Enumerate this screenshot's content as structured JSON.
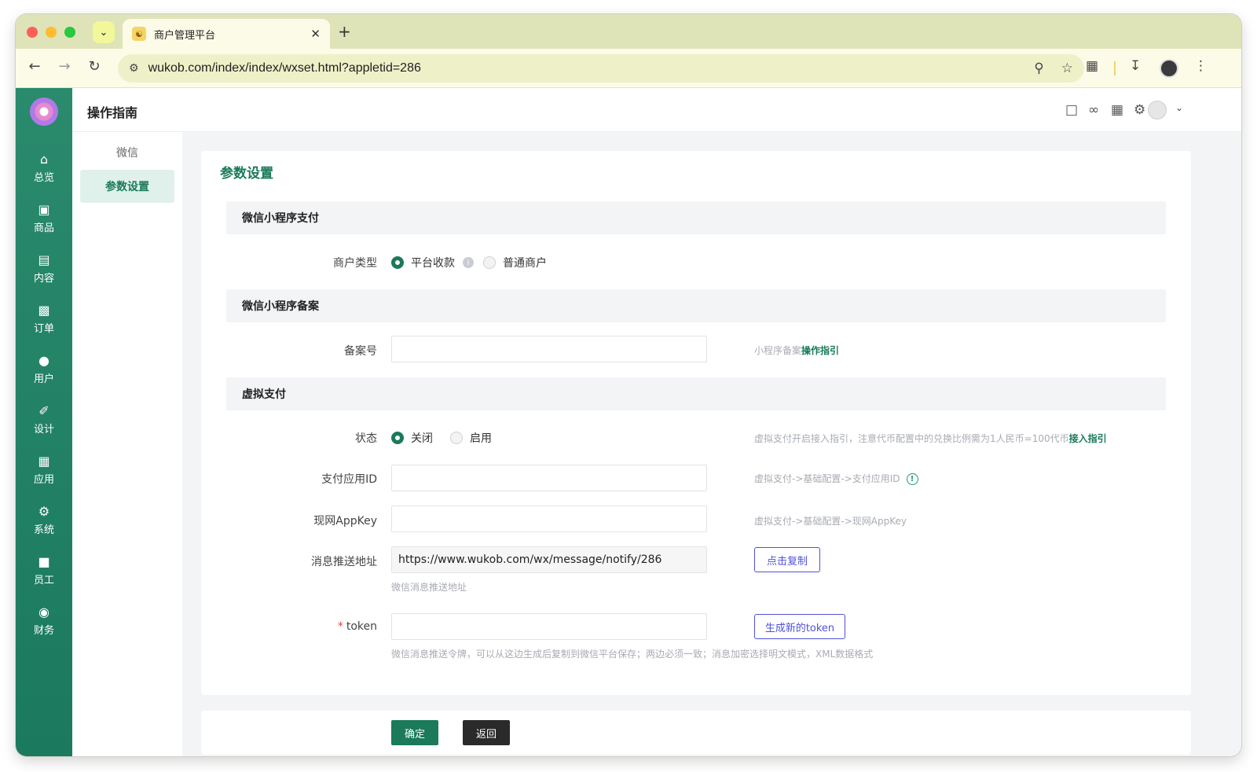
{
  "browser": {
    "tab_title": "商户管理平台",
    "url": "wukob.com/index/index/wxset.html?appletid=286"
  },
  "sidebar": {
    "items": [
      {
        "label": "总览",
        "icon": "home-icon"
      },
      {
        "label": "商品",
        "icon": "bag-icon"
      },
      {
        "label": "内容",
        "icon": "document-icon"
      },
      {
        "label": "订单",
        "icon": "clipboard-icon"
      },
      {
        "label": "用户",
        "icon": "user-icon"
      },
      {
        "label": "设计",
        "icon": "brush-icon"
      },
      {
        "label": "应用",
        "icon": "apps-grid-icon"
      },
      {
        "label": "系统",
        "icon": "gear-icon"
      },
      {
        "label": "员工",
        "icon": "lock-icon"
      },
      {
        "label": "财务",
        "icon": "money-bag-icon"
      }
    ]
  },
  "header": {
    "title": "操作指南"
  },
  "subnav": {
    "group": "微信",
    "active_item": "参数设置"
  },
  "form": {
    "title": "参数设置",
    "sections": {
      "pay": "微信小程序支付",
      "record": "微信小程序备案",
      "virtual": "虚拟支付"
    },
    "merchant_type": {
      "label": "商户类型",
      "options": [
        "平台收款",
        "普通商户"
      ],
      "selected": "平台收款"
    },
    "record_no": {
      "label": "备案号",
      "value": "",
      "hint_text": "小程序备案",
      "hint_link": "操作指引"
    },
    "status": {
      "label": "状态",
      "options": [
        "关闭",
        "启用"
      ],
      "selected": "关闭",
      "hint_text": "虚拟支付开启接入指引，注意代币配置中的兑换比例需为1人民币=100代币",
      "hint_link": "接入指引"
    },
    "pay_app_id": {
      "label": "支付应用ID",
      "value": "",
      "hint": "虚拟支付->基础配置->支付应用ID"
    },
    "appkey": {
      "label": "现网AppKey",
      "value": "",
      "hint": "虚拟支付->基础配置->现网AppKey"
    },
    "push_url": {
      "label": "消息推送地址",
      "value": "https://www.wukob.com/wx/message/notify/286",
      "help": "微信消息推送地址",
      "copy_button": "点击复制"
    },
    "token": {
      "required_mark": "*",
      "label": "token",
      "value": "",
      "help": "微信消息推送令牌，可以从这边生成后复制到微信平台保存；两边必须一致；消息加密选择明文模式，XML数据格式",
      "generate_button": "生成新的token"
    }
  },
  "footer": {
    "confirm": "确定",
    "back": "返回"
  },
  "colors": {
    "brand": "#1a7a59",
    "sidebar": "#1b7a5e",
    "outline_button": "#4f52d8"
  }
}
